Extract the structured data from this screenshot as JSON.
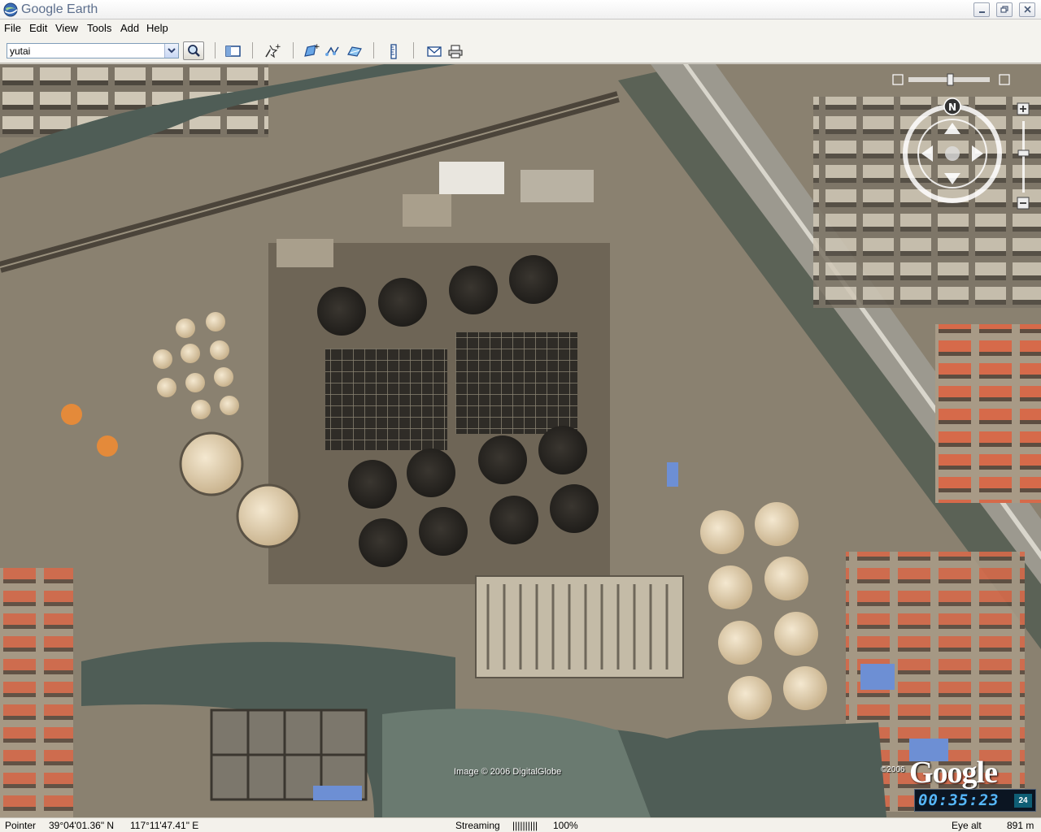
{
  "window": {
    "title": "Google Earth"
  },
  "menu": [
    "File",
    "Edit",
    "View",
    "Tools",
    "Add",
    "Help"
  ],
  "toolbar": {
    "search_value": "yutai",
    "icons": [
      "search-icon",
      "sidebar-toggle-icon",
      "placemark-icon",
      "polygon-icon",
      "path-icon",
      "image-overlay-icon",
      "ruler-icon",
      "email-icon",
      "print-icon"
    ]
  },
  "map": {
    "image_credit": "Image © 2006 DigitalGlobe",
    "copyright_year": "©2006",
    "logo": "Google",
    "clock": {
      "time": "00:35:23",
      "badge": "24"
    },
    "compass_north": "N"
  },
  "status": {
    "pointer_label": "Pointer",
    "latitude": "39°04'01.36\" N",
    "longitude": "117°11'47.41\" E",
    "streaming_label": "Streaming",
    "streaming_bars": "||||||||||",
    "streaming_percent": "100%",
    "eye_alt_label": "Eye alt",
    "eye_alt_value": "891 m"
  },
  "colors": {
    "title_text": "#5d6f8d",
    "clock_text": "#56b8ff",
    "water": "#4f5d56",
    "roof_red": "#d66a4a",
    "tank_light": "#e6d6b8",
    "tank_dark": "#2a2824"
  }
}
